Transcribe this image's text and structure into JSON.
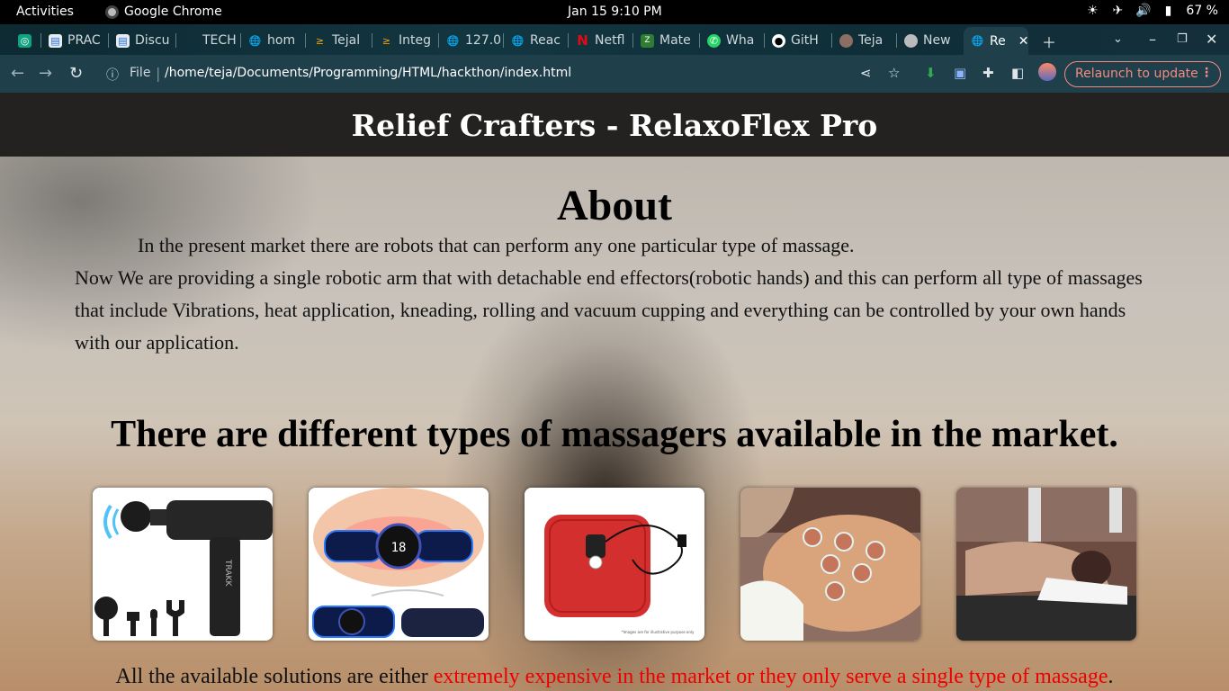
{
  "os": {
    "activities": "Activities",
    "app_name": "Google Chrome",
    "clock": "Jan 15   9:10 PM",
    "battery": "67 %"
  },
  "tabs": [
    {
      "label": "",
      "favicon": "chatgpt-icon",
      "fav_color": "#10a37f"
    },
    {
      "label": "PRAC",
      "favicon": "document-icon",
      "fav_color": "#e8eaed"
    },
    {
      "label": "Discu",
      "favicon": "document-icon",
      "fav_color": "#e8eaed"
    },
    {
      "label": "TECH",
      "favicon": "tech-icon",
      "fav_color": "#333"
    },
    {
      "label": "hom",
      "favicon": "globe-icon",
      "fav_color": "#9aa0a6"
    },
    {
      "label": "Tejal",
      "favicon": "codechef-icon",
      "fav_color": "#f4a300"
    },
    {
      "label": "Integ",
      "favicon": "codechef-icon",
      "fav_color": "#f4a300"
    },
    {
      "label": "127.0",
      "favicon": "globe-icon",
      "fav_color": "#9aa0a6"
    },
    {
      "label": "Reac",
      "favicon": "globe-icon",
      "fav_color": "#9aa0a6"
    },
    {
      "label": "Netfl",
      "favicon": "netflix-icon",
      "fav_color": "#e50914"
    },
    {
      "label": "Mate",
      "favicon": "zoho-icon",
      "fav_color": "#4caf50"
    },
    {
      "label": "Wha",
      "favicon": "whatsapp-icon",
      "fav_color": "#25d366"
    },
    {
      "label": "GitH",
      "favicon": "github-icon",
      "fav_color": "#fff"
    },
    {
      "label": "Teja",
      "favicon": "profile-icon",
      "fav_color": "#8d6e63"
    },
    {
      "label": "New",
      "favicon": "chrome-icon",
      "fav_color": "#9aa0a6"
    },
    {
      "label": "Re",
      "favicon": "globe-icon",
      "fav_color": "#9aa0a6",
      "active": true
    }
  ],
  "omnibox": {
    "scheme_label": "File",
    "url": "/home/teja/Documents/Programming/HTML/hackthon/index.html"
  },
  "relaunch_label": "Relaunch to update",
  "page": {
    "header": "Relief Crafters - RelaxoFlex Pro",
    "about_title": "About",
    "about_line1": "In the present market there are robots that can perform any one particular type of massage.",
    "about_line2": "Now We are providing a single robotic arm that with detachable end effectors(robotic hands) and this can perform all type of massages that include Vibrations, heat application, kneading, rolling and vacuum cupping and everything can be controlled by your own hands with our application.",
    "types_title": "There are different types of massagers available in the market.",
    "cards": [
      {
        "name": "massage-gun-image",
        "brand": "TRAKK"
      },
      {
        "name": "ems-neck-massager-image",
        "display": "18"
      },
      {
        "name": "heat-bag-image",
        "caption": "*Images are for illustrative purpose only"
      },
      {
        "name": "cupping-therapy-image"
      },
      {
        "name": "massage-chair-image"
      }
    ],
    "footer_prefix": "All the available solutions are either ",
    "footer_highlight": "extremely expensive in the market or they only serve a single type of massage",
    "footer_suffix": "."
  }
}
